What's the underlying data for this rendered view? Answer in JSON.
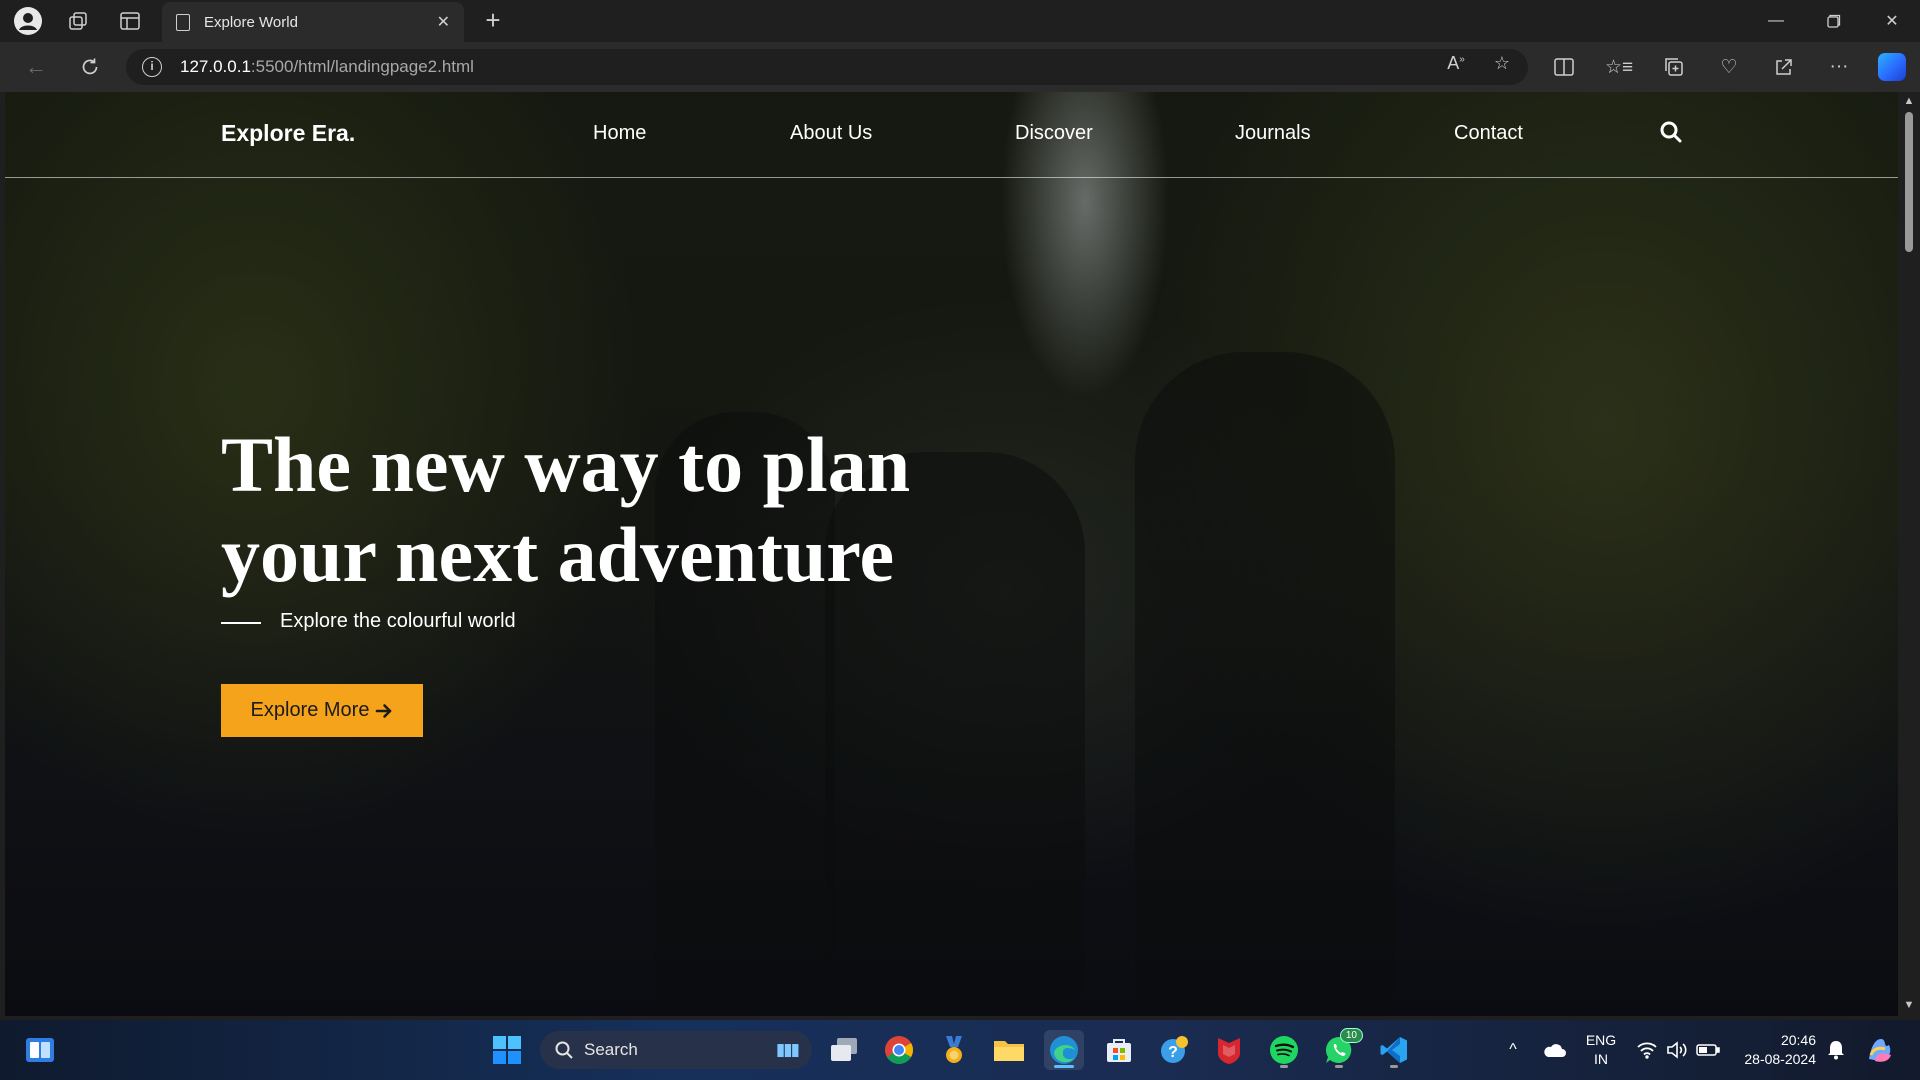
{
  "browser": {
    "tab_title": "Explore World",
    "url_host": "127.0.0.1",
    "url_rest": ":5500/html/landingpage2.html",
    "new_tab_label": "+"
  },
  "site": {
    "brand": "Explore Era.",
    "nav": [
      "Home",
      "About Us",
      "Discover",
      "Journals",
      "Contact"
    ],
    "headline_line1": "The new way to plan",
    "headline_line2": "your next adventure",
    "tagline": "Explore the colourful world",
    "cta_label": "Explore More",
    "accent_color": "#f5a31a"
  },
  "taskbar": {
    "search_label": "Search",
    "lang_line1": "ENG",
    "lang_line2": "IN",
    "time": "20:46",
    "date": "28-08-2024",
    "whatsapp_badge": "10"
  }
}
